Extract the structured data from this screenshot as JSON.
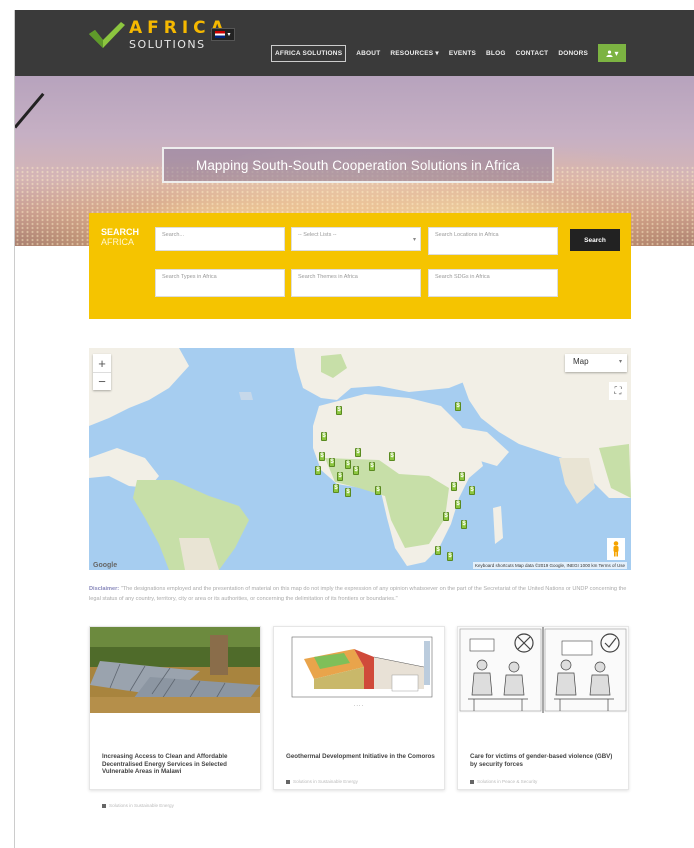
{
  "header": {
    "logo": {
      "word1": "AFRICA",
      "word2": "SOLUTIONS"
    },
    "language": "EN",
    "nav": [
      {
        "label": "AFRICA SOLUTIONS",
        "active": true
      },
      {
        "label": "ABOUT",
        "active": false
      },
      {
        "label": "RESOURCES ▾",
        "active": false
      },
      {
        "label": "EVENTS",
        "active": false
      },
      {
        "label": "BLOG",
        "active": false
      },
      {
        "label": "CONTACT",
        "active": false
      },
      {
        "label": "DONORS",
        "active": false
      }
    ],
    "user_button": "▾"
  },
  "hero": {
    "title": "Mapping South-South Cooperation Solutions in Africa"
  },
  "search": {
    "label_line1": "SEARCH",
    "label_line2": "AFRICA",
    "keyword_placeholder": "Search...",
    "category_placeholder": "-- Select Lists --",
    "location_placeholder": "Search Locations in Africa",
    "types_placeholder": "Search Types in Africa",
    "themes_placeholder": "Search Themes in Africa",
    "sdgs_placeholder": "Search SDGs in Africa",
    "button": "Search"
  },
  "map": {
    "zoom_in": "+",
    "zoom_out": "−",
    "type": "Map",
    "google": "Google",
    "attribution": "Keyboard shortcuts   Map data ©2019 Google, INEGI   1000 km   Terms of Use",
    "colors": {
      "water": "#a6cdf0",
      "land": "#f2efe6",
      "green": "#c7dfa8",
      "pin": "#8cc63f"
    }
  },
  "disclaimer": {
    "lead": "Disclaimer:",
    "text": "\"The designations employed and the presentation of material on this map do not imply the expression of any opinion whatsoever on the part of the Secretariat of the United Nations or UNDP concerning the legal status of any country, territory, city or area or its authorities, or concerning the delimitation of its frontiers or boundaries.\""
  },
  "cards": [
    {
      "title": "Increasing Access to Clean and Affordable Decentralised Energy Services in Selected Vulnerable Areas in Malawi",
      "meta": "Solutions in Sustainable Energy"
    },
    {
      "title": "Geothermal Development Initiative in the Comoros",
      "meta": "Solutions in Sustainable Energy"
    },
    {
      "title": "Care for victims of gender-based violence (GBV) by security forces",
      "meta": "Solutions in Peace & Security"
    }
  ]
}
